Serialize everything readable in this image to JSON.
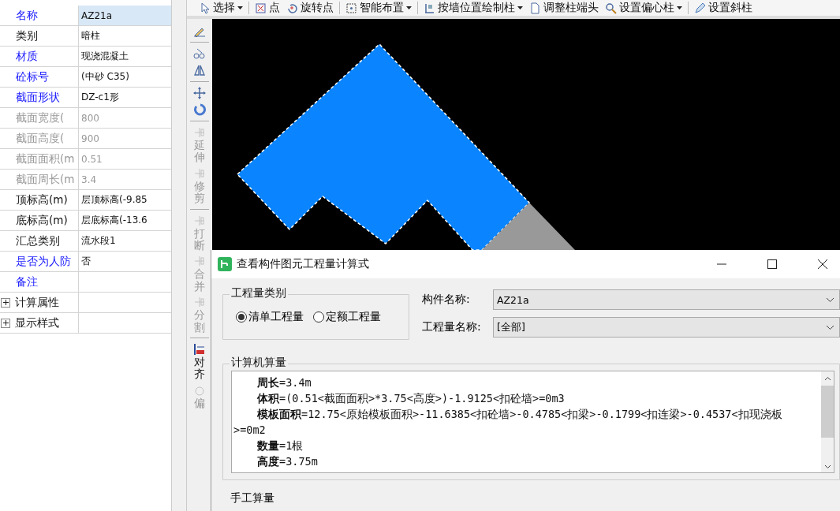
{
  "properties": [
    {
      "label": "名称",
      "value": "AZ21a",
      "kind": "public",
      "selected": true
    },
    {
      "label": "类别",
      "value": "暗柱",
      "kind": "private",
      "selected": false
    },
    {
      "label": "材质",
      "value": "现浇混凝土",
      "kind": "public",
      "selected": false
    },
    {
      "label": "砼标号",
      "value": "(中砂 C35)",
      "kind": "public",
      "selected": false
    },
    {
      "label": "截面形状",
      "value": "DZ-c1形",
      "kind": "public",
      "selected": false
    },
    {
      "label": "截面宽度(",
      "value": "800",
      "kind": "readonly",
      "selected": false
    },
    {
      "label": "截面高度(",
      "value": "900",
      "kind": "readonly",
      "selected": false
    },
    {
      "label": "截面面积(m",
      "value": "0.51",
      "kind": "readonly",
      "selected": false
    },
    {
      "label": "截面周长(m",
      "value": "3.4",
      "kind": "readonly",
      "selected": false
    },
    {
      "label": "顶标高(m)",
      "value": "层顶标高(-9.85",
      "kind": "private",
      "selected": false
    },
    {
      "label": "底标高(m)",
      "value": "层底标高(-13.6",
      "kind": "private",
      "selected": false
    },
    {
      "label": "汇总类别",
      "value": "流水段1",
      "kind": "private",
      "selected": false
    },
    {
      "label": "是否为人防",
      "value": "否",
      "kind": "public",
      "selected": false
    },
    {
      "label": "备注",
      "kind": "public",
      "selected": false
    },
    {
      "label": "计算属性",
      "kind": "group",
      "expanded": false,
      "selected": false
    },
    {
      "label": "显示样式",
      "kind": "group",
      "expanded": false,
      "selected": false
    }
  ],
  "toolbar": [
    {
      "label": "选择",
      "kind": "cursor",
      "dropdown": true
    },
    {
      "label": "点",
      "kind": "point",
      "dropdown": false
    },
    {
      "label": "旋转点",
      "kind": "rotate",
      "dropdown": false
    },
    {
      "label": "智能布置",
      "kind": "grid",
      "dropdown": true
    },
    {
      "label": "按墙位置绘制柱",
      "kind": "column",
      "dropdown": true
    },
    {
      "label": "调整柱端头",
      "kind": "page",
      "dropdown": false
    },
    {
      "label": "设置偏心柱",
      "kind": "magnifier",
      "dropdown": true
    },
    {
      "label": "设置斜柱",
      "kind": "pencil",
      "dropdown": false
    }
  ],
  "side_tools": [
    {
      "kind": "brush",
      "disabled": false
    },
    {
      "kind": "copy",
      "disabled": false
    },
    {
      "kind": "mirror",
      "disabled": false
    },
    {
      "kind": "move",
      "disabled": false
    },
    {
      "kind": "rotate",
      "disabled": false
    },
    {
      "kind": "extend",
      "label": "延伸",
      "disabled": true
    },
    {
      "kind": "trim",
      "label": "修剪",
      "disabled": true
    },
    {
      "kind": "break",
      "label": "打断",
      "disabled": true
    },
    {
      "kind": "merge",
      "label": "合并",
      "disabled": true
    },
    {
      "kind": "split",
      "label": "分割",
      "disabled": true
    },
    {
      "kind": "align",
      "label": "对齐",
      "disabled": false
    },
    {
      "kind": "offset",
      "label": "偏",
      "disabled": true
    }
  ],
  "dialog": {
    "title": "查看构件图元工程量计算式",
    "quantity_type": {
      "legend": "工程量类别",
      "options": [
        {
          "label": "清单工程量",
          "selected": true
        },
        {
          "label": "定额工程量",
          "selected": false
        }
      ]
    },
    "fields": [
      {
        "label": "构件名称:",
        "value": "AZ21a"
      },
      {
        "label": "工程量名称:",
        "value": "[全部]"
      }
    ],
    "computed": {
      "legend": "计算机算量",
      "lines": [
        "**周长**=3.4m",
        "**体积**=(0.51<截面面积>*3.75<高度>)-1.9125<扣砼墙>=0m3",
        "**模板面积**=12.75<原始模板面积>-11.6385<扣砼墙>-0.4785<扣梁>-0.1799<扣连梁>-0.4537<扣现浇板>=0m2",
        "**数量**=1根",
        "**高度**=3.75m"
      ]
    },
    "manual": {
      "legend": "手工算量"
    }
  }
}
